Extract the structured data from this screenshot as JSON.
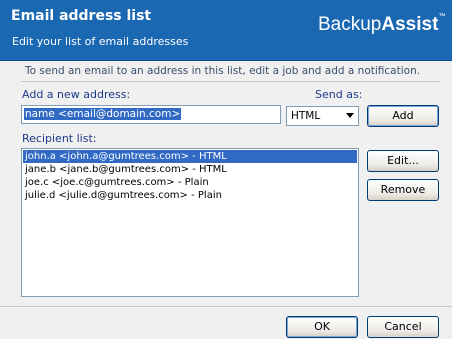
{
  "header": {
    "title": "Email address list",
    "subtitle": "Edit your list of email addresses",
    "logo_part1": "Backup",
    "logo_part2": "Assist",
    "logo_tm": "™"
  },
  "instruction": "To send an email to an address in this list, edit a job and add a notification.",
  "add_section": {
    "label": "Add a new address:",
    "input_value": "name <email@domain.com>",
    "send_as_label": "Send as:",
    "send_as_value": "HTML",
    "add_button": "Add"
  },
  "recipients": {
    "label": "Recipient list:",
    "items": [
      {
        "text": "john.a <john.a@gumtrees.com> - HTML",
        "selected": true
      },
      {
        "text": "jane.b <jane.b@gumtrees.com> - HTML",
        "selected": false
      },
      {
        "text": "joe.c <joe.c@gumtrees.com> - Plain",
        "selected": false
      },
      {
        "text": "julie.d <julie.d@gumtrees.com> - Plain",
        "selected": false
      }
    ],
    "edit_button": "Edit...",
    "remove_button": "Remove"
  },
  "footer": {
    "ok_button": "OK",
    "cancel_button": "Cancel"
  }
}
